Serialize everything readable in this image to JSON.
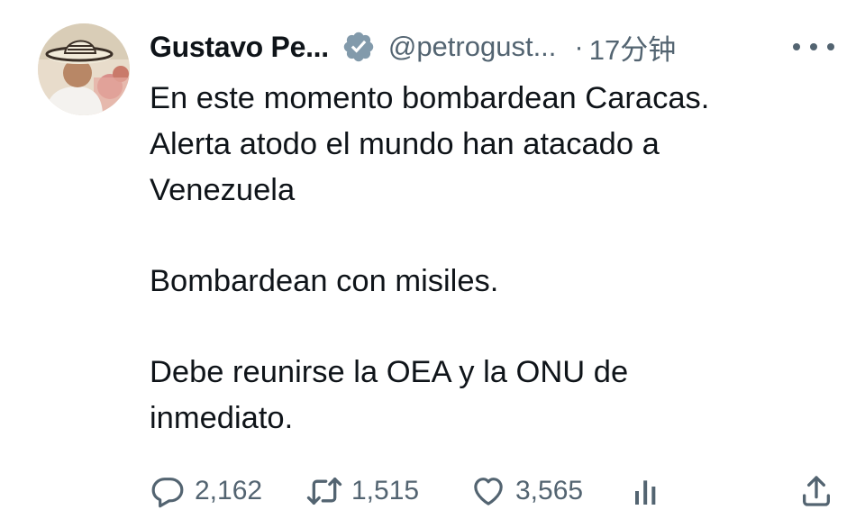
{
  "author": {
    "display_name": "Gustavo Pe...",
    "handle": "@petrogust...",
    "separator": "·",
    "time": "17分钟",
    "verified_badge": "verified-badge-icon",
    "more_icon": "more-dots-icon"
  },
  "tweet": {
    "paragraphs": [
      [
        "En este momento bombardean Caracas.",
        "Alerta atodo el mundo han atacado a",
        "Venezuela"
      ],
      [
        "Bombardean con misiles."
      ],
      [
        "Debe reunirse la OEA y la ONU de",
        "inmediato."
      ]
    ]
  },
  "actions": {
    "reply_count": "2,162",
    "retweet_count": "1,515",
    "like_count": "3,565",
    "views_count": "",
    "icons": [
      "reply-icon",
      "retweet-icon",
      "like-icon",
      "views-icon",
      "share-icon"
    ]
  },
  "colors": {
    "text": "#0f1419",
    "secondary": "#536471",
    "badge": "#829aab"
  }
}
